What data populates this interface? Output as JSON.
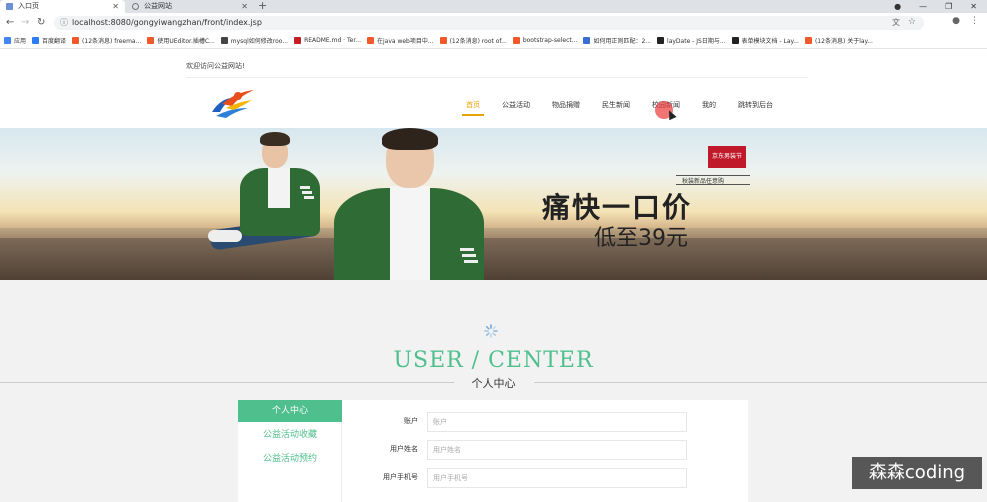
{
  "browser": {
    "tabs": [
      {
        "label": "入口页",
        "active": true
      },
      {
        "label": "公益网站",
        "active": false
      }
    ],
    "url": "localhost:8080/gongyiwangzhan/front/index.jsp",
    "bookmarks": [
      {
        "label": "应用",
        "color": "#4285f4"
      },
      {
        "label": "百度翻译",
        "color": "#2d7cf6"
      },
      {
        "label": "(12条消息) freema...",
        "color": "#f05a2a"
      },
      {
        "label": "使用UEditor.插槽C...",
        "color": "#f05a2a"
      },
      {
        "label": "mysql如何修改roo...",
        "color": "#444444"
      },
      {
        "label": "README.md · Ter...",
        "color": "#c71d23"
      },
      {
        "label": "在java web项目中...",
        "color": "#f05a2a"
      },
      {
        "label": "(12条消息) root of...",
        "color": "#f05a2a"
      },
      {
        "label": "bootstrap-select...",
        "color": "#f05a2a"
      },
      {
        "label": "如何用正则匹配：2...",
        "color": "#3b6fd6"
      },
      {
        "label": "layDate - JS日期与...",
        "color": "#222222"
      },
      {
        "label": "表单模块文档 - Lay...",
        "color": "#222222"
      },
      {
        "label": "(12条消息) 关于lay...",
        "color": "#f05a2a"
      }
    ]
  },
  "header": {
    "welcome": "欢迎访问公益网站!",
    "nav": [
      "首页",
      "公益活动",
      "物品捐赠",
      "民生新闻",
      "校园新闻",
      "我的",
      "跳转到后台"
    ],
    "active_nav": 0
  },
  "banner": {
    "badge": "京东男装节",
    "sub": "秋装新品任意购",
    "main": "痛快一口价",
    "price": "低至39元"
  },
  "section": {
    "title_en": "USER / CENTER",
    "title_cn": "个人中心"
  },
  "sidebar": [
    {
      "label": "个人中心",
      "active": true
    },
    {
      "label": "公益活动收藏",
      "active": false
    },
    {
      "label": "公益活动预约",
      "active": false
    }
  ],
  "form": [
    {
      "label": "账户",
      "placeholder": "账户"
    },
    {
      "label": "用户姓名",
      "placeholder": "用户姓名"
    },
    {
      "label": "用户手机号",
      "placeholder": "用户手机号"
    }
  ],
  "watermark": "森森coding",
  "colors": {
    "accent": "#4fc08d",
    "nav_active": "#e8a400"
  }
}
